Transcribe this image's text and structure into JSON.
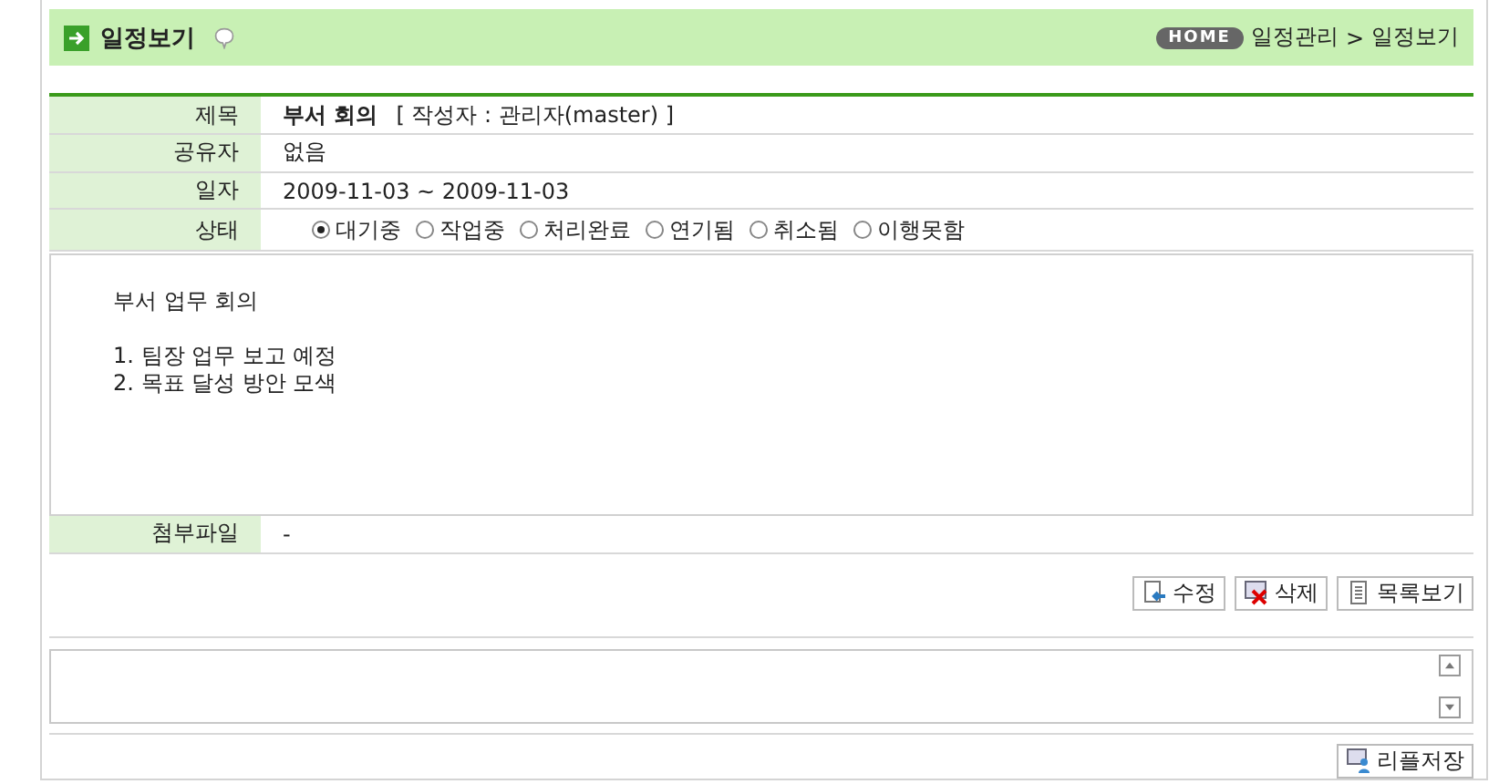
{
  "header": {
    "title": "일정보기",
    "home_badge": "HOME",
    "breadcrumb": [
      "일정관리",
      "일정보기"
    ],
    "breadcrumb_separator": ">"
  },
  "fields": [
    {
      "kind": "title",
      "label": "제목",
      "value": "부서 회의",
      "author": "[ 작성자 : 관리자(master) ]"
    },
    {
      "kind": "text",
      "label": "공유자",
      "value": "없음"
    },
    {
      "kind": "text",
      "label": "일자",
      "value": "2009-11-03 ~ 2009-11-03"
    },
    {
      "kind": "status",
      "label": "상태",
      "options": [
        {
          "label": "대기중",
          "selected": true
        },
        {
          "label": "작업중",
          "selected": false
        },
        {
          "label": "처리완료",
          "selected": false
        },
        {
          "label": "연기됨",
          "selected": false
        },
        {
          "label": "취소됨",
          "selected": false
        },
        {
          "label": "이행못함",
          "selected": false
        }
      ]
    }
  ],
  "body": [
    [
      "부서 업무 회의"
    ],
    [
      "1. 팀장 업무 보고 예정",
      "2. 목표 달성 방안 모색"
    ]
  ],
  "attachment": {
    "label": "첨부파일",
    "value": "-"
  },
  "buttons": [
    {
      "kind": "edit",
      "label": "수정"
    },
    {
      "kind": "delete",
      "label": "삭제"
    },
    {
      "kind": "list",
      "label": "목록보기"
    }
  ],
  "comment_button": {
    "label": "리플저장"
  }
}
